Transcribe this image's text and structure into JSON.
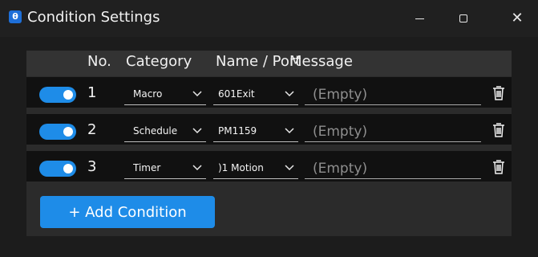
{
  "window": {
    "title": "Condition Settings",
    "app_icon_glyph": "θ",
    "minimize_glyph": "minimize-icon",
    "maximize_glyph": "maximize-icon",
    "close_glyph": "✕"
  },
  "table": {
    "headers": {
      "no": "No.",
      "category": "Category",
      "name_port": "Name / Port",
      "message": "Message"
    },
    "rows": [
      {
        "enabled": true,
        "no": "1",
        "category": "Macro",
        "name": "601Exit",
        "message_placeholder": "(Empty)"
      },
      {
        "enabled": true,
        "no": "2",
        "category": "Schedule",
        "name": "PM1159",
        "message_placeholder": "(Empty)"
      },
      {
        "enabled": true,
        "no": "3",
        "category": "Timer",
        "name": ")1 Motion",
        "message_placeholder": "(Empty)"
      }
    ]
  },
  "add_button": {
    "label": "+ Add Condition"
  },
  "colors": {
    "accent": "#1e8ce8",
    "background": "#1c1c1c",
    "panel": "#2b2b2b",
    "row": "#111111"
  }
}
